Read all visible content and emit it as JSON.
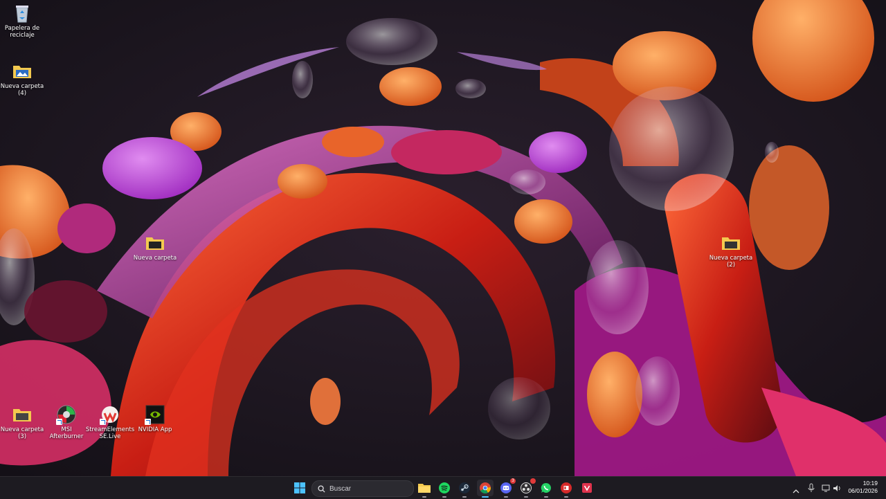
{
  "desktop": {
    "icons": [
      {
        "label": "Papelera de\nreciclaje",
        "icon": "recycle-bin-icon"
      },
      {
        "label": "Nueva carpeta\n(4)",
        "icon": "folder-icon"
      },
      {
        "label": "Nueva carpeta",
        "icon": "folder-icon"
      },
      {
        "label": "Nueva carpeta\n(2)",
        "icon": "folder-icon"
      },
      {
        "label": "Nueva carpeta\n(3)",
        "icon": "folder-icon"
      },
      {
        "label": "MSI Afterburner",
        "icon": "msi-afterburner-icon"
      },
      {
        "label": "StreamElements\nSE.Live",
        "icon": "streamelements-icon"
      },
      {
        "label": "NVIDIA App",
        "icon": "nvidia-icon"
      }
    ]
  },
  "taskbar": {
    "search_placeholder": "Buscar",
    "pinned": [
      "windows-start-icon",
      "file-explorer-icon",
      "spotify-icon",
      "steam-icon",
      "chrome-icon",
      "discord-icon",
      "obs-icon",
      "whatsapp-icon",
      "app-red-icon",
      "app-pink-icon"
    ],
    "discord_badge": "3",
    "clock": {
      "time": "10:19",
      "date": "06/01/2026"
    }
  },
  "colors": {
    "accent": "#0078d4",
    "taskbar": "#1d1b21"
  }
}
